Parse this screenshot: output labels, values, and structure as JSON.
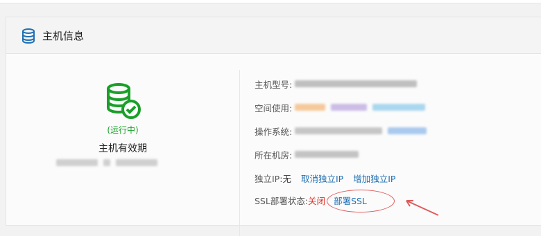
{
  "panel": {
    "title": "主机信息"
  },
  "left": {
    "status": "(运行中)",
    "expiry_title": "主机有效期"
  },
  "details": {
    "model_label": "主机型号:",
    "space_label": "空间使用:",
    "os_label": "操作系统:",
    "room_label": "所在机房:",
    "ip_label": "独立IP:",
    "ip_value": "无",
    "ip_cancel": "取消独立IP",
    "ip_add": "增加独立IP",
    "ssl_label": "SSL部署状态:",
    "ssl_status": "关闭",
    "ssl_deploy": "部署SSL"
  },
  "colors": {
    "accent": "#1f6fb3",
    "running": "#1a9f29",
    "alert": "#e02e24",
    "annotation": "#e05a5a"
  },
  "icons": {
    "header": "database-icon",
    "status": "server-check-icon"
  }
}
